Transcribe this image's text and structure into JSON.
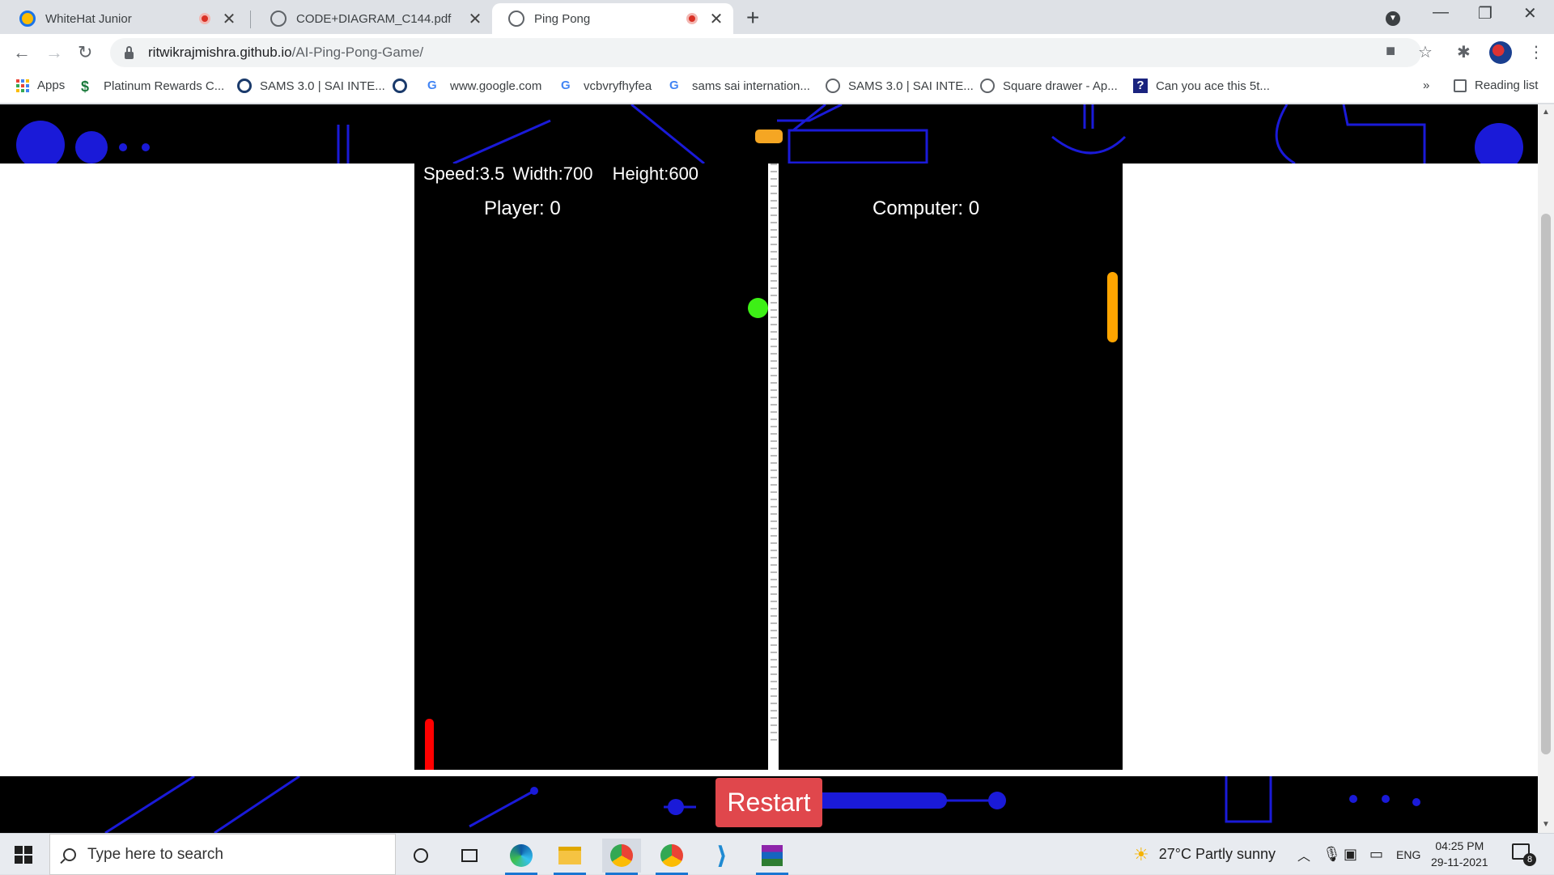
{
  "browser": {
    "tabs": [
      {
        "title": "WhiteHat Junior",
        "recording": true,
        "favicon_color": "#1a73e8"
      },
      {
        "title": "CODE+DIAGRAM_C144.pdf",
        "recording": false,
        "favicon_color": "#5f6368"
      },
      {
        "title": "Ping Pong",
        "recording": true,
        "favicon_color": "#5f6368",
        "active": true
      }
    ],
    "url_host": "ritwikrajmishra.github.io",
    "url_path": "/AI-Ping-Pong-Game/",
    "bookmarks": [
      {
        "label": "Apps",
        "icon": "apps-grid-icon"
      },
      {
        "label": "Platinum Rewards C...",
        "icon": "rewards-icon"
      },
      {
        "label": "SAMS 3.0 | SAI INTE...",
        "icon": "sams-icon"
      },
      {
        "label": "",
        "icon": "sams-icon"
      },
      {
        "label": "www.google.com",
        "icon": "google-icon"
      },
      {
        "label": "vcbvryfhyfea",
        "icon": "google-icon"
      },
      {
        "label": "sams sai internation...",
        "icon": "google-icon"
      },
      {
        "label": "SAMS 3.0 | SAI INTE...",
        "icon": "globe-icon"
      },
      {
        "label": "Square drawer - Ap...",
        "icon": "globe-icon"
      },
      {
        "label": "Can you ace this 5t...",
        "icon": "question-icon"
      }
    ],
    "bookmarks_overflow": "»",
    "reading_list": "Reading list"
  },
  "game": {
    "speed_label": "Speed:3.5",
    "width_label": "Width:700",
    "height_label": "Height:600",
    "player_score": "Player: 0",
    "computer_score": "Computer: 0",
    "restart_label": "Restart",
    "colors": {
      "player_paddle": "#ff0000",
      "computer_paddle": "#ffa500",
      "ball": "#3df016",
      "restart_button": "#e0474c"
    }
  },
  "taskbar": {
    "search_placeholder": "Type here to search",
    "weather": "27°C  Partly sunny",
    "language": "ENG",
    "time": "04:25 PM",
    "date": "29-11-2021",
    "notifications": "8"
  }
}
